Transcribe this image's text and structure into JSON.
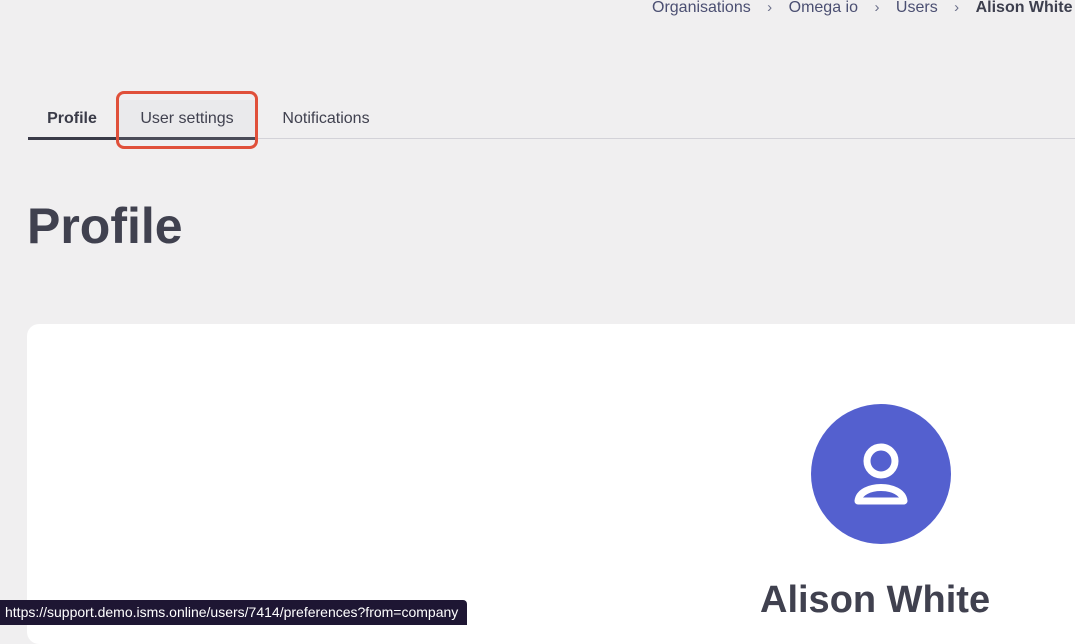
{
  "breadcrumb": {
    "items": [
      "Organisations",
      "Omega io",
      "Users"
    ],
    "current": "Alison White",
    "separator": "›"
  },
  "tabs": [
    {
      "label": "Profile",
      "active": true
    },
    {
      "label": "User settings",
      "active": false
    },
    {
      "label": "Notifications",
      "active": false
    }
  ],
  "page": {
    "title": "Profile"
  },
  "profile_card": {
    "avatar_icon": "user-icon",
    "name": "Alison White"
  },
  "status_bar": {
    "url": "https://support.demo.isms.online/users/7414/preferences?from=company"
  },
  "colors": {
    "background": "#f0eff0",
    "avatar": "#5460cf",
    "highlight": "#e0503a",
    "text": "#40414f"
  }
}
